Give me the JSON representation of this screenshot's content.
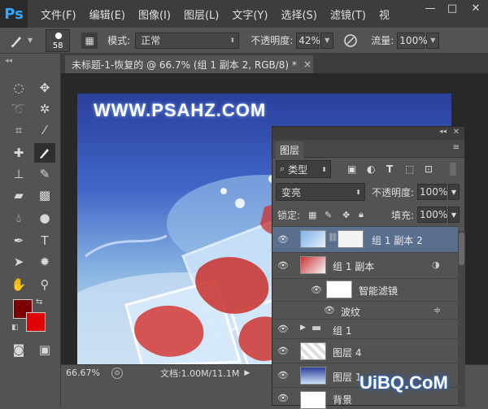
{
  "app": {
    "logo": "Ps"
  },
  "menu": {
    "items": [
      "文件(F)",
      "编辑(E)",
      "图像(I)",
      "图层(L)",
      "文字(Y)",
      "选择(S)",
      "滤镜(T)",
      "视"
    ]
  },
  "window_controls": {
    "minimize": "—",
    "maximize": "□",
    "close": "✕"
  },
  "options_bar": {
    "brush_size": "58",
    "mode_label": "模式:",
    "mode_value": "正常",
    "opacity_label": "不透明度:",
    "opacity_value": "42%",
    "flow_label": "流量:",
    "flow_value": "100%"
  },
  "document": {
    "tab_title": "未标题-1-恢复的 @ 66.7% (组 1 副本 2, RGB/8) *",
    "close": "×",
    "watermark": "WWW.PSAHZ.COM"
  },
  "status": {
    "zoom": "66.67%",
    "doc_info": "文档:1.00M/11.1M"
  },
  "layers_panel": {
    "tab": "图层",
    "filter_kind": "类型",
    "blend_mode": "变亮",
    "opacity_label": "不透明度:",
    "opacity_value": "100%",
    "lock_label": "锁定:",
    "fill_label": "填充:",
    "fill_value": "100%",
    "layers": [
      {
        "name": "组 1 副本 2",
        "selected": true
      },
      {
        "name": "组 1 副本",
        "selected": false
      },
      {
        "name": "智能滤镜",
        "selected": false
      },
      {
        "name": "波纹",
        "selected": false
      },
      {
        "name": "组 1",
        "selected": false
      },
      {
        "name": "图层 4",
        "selected": false
      },
      {
        "name": "图层 1",
        "selected": false
      },
      {
        "name": "背景",
        "selected": false
      }
    ]
  },
  "colors": {
    "foreground": "#7a0000",
    "background": "#e00000",
    "selected_layer": "#5a6f8e",
    "ps_blue": "#31a8ff"
  },
  "site_watermark": "UiBQ.CoM"
}
